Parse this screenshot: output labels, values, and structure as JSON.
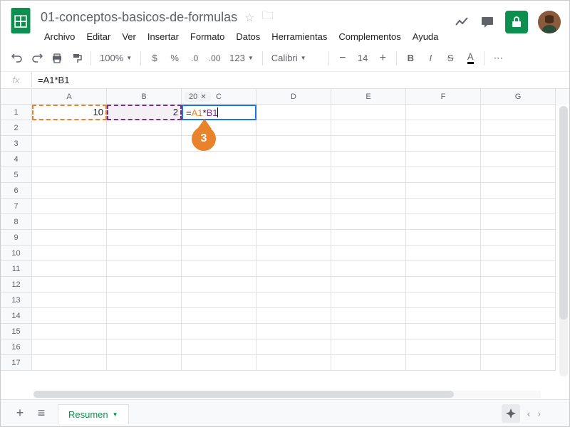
{
  "doc_title": "01-conceptos-basicos-de-formulas",
  "menus": [
    "Archivo",
    "Editar",
    "Ver",
    "Insertar",
    "Formato",
    "Datos",
    "Herramientas",
    "Complementos",
    "Ayuda"
  ],
  "toolbar": {
    "zoom": "100%",
    "font": "Calibri",
    "size": "14",
    "number_format": "123"
  },
  "formula_bar": "=A1*B1",
  "columns": [
    "A",
    "B",
    "C",
    "D",
    "E",
    "F",
    "G"
  ],
  "row_count": 17,
  "cells": {
    "A1": "10",
    "B1": "2"
  },
  "active_cell": {
    "ref": "C1",
    "parts": [
      {
        "text": "=",
        "cls": ""
      },
      {
        "text": "A1",
        "cls": "orange"
      },
      {
        "text": "*",
        "cls": ""
      },
      {
        "text": "B1",
        "cls": "purple"
      }
    ]
  },
  "preview_value": "20",
  "balloon_step": "3",
  "sheet_tab": "Resumen"
}
